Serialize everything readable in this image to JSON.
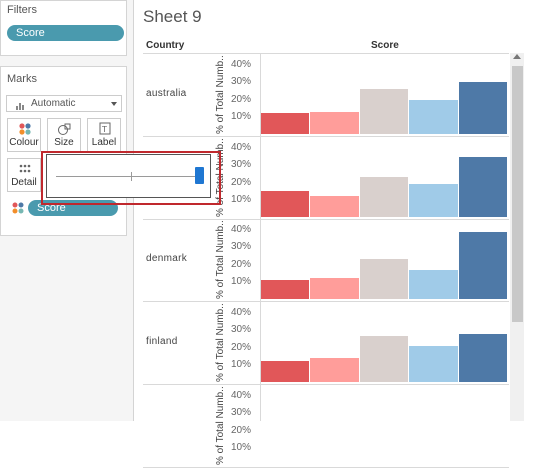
{
  "filters": {
    "title": "Filters",
    "pill": "Score"
  },
  "marks": {
    "title": "Marks",
    "mark_type": "Automatic",
    "buttons": [
      {
        "label": "Colour",
        "icon": "colour-dots-icon"
      },
      {
        "label": "Size",
        "icon": "size-shapes-icon"
      },
      {
        "label": "Label",
        "icon": "text-label-icon"
      },
      {
        "label": "Detail",
        "icon": "detail-dots-icon"
      }
    ],
    "score_pill": "Score"
  },
  "sheet": {
    "title": "Sheet 9",
    "column_header": "Country",
    "score_header": "Score",
    "y_axis_title": "% of Total Numb..",
    "ticks": [
      "40%",
      "30%",
      "20%",
      "10%"
    ],
    "countries": [
      "australia",
      "",
      "denmark",
      "finland",
      ""
    ]
  },
  "colors": {
    "pill": "#4a9aae",
    "bins": [
      "#e15759",
      "#ff9d9a",
      "#d9d0cd",
      "#a0cbe8",
      "#4e79a7"
    ],
    "popup_border": "#c0282d",
    "slider_thumb": "#1f77d2"
  },
  "chart_data": {
    "type": "bar",
    "x_header": "Score",
    "y_title": "% of Total Numb..",
    "ylim": [
      0,
      45
    ],
    "y_ticks": [
      "10%",
      "20%",
      "30%",
      "40%"
    ],
    "panels": [
      {
        "country": "australia",
        "values": [
          12,
          13,
          26,
          20,
          30
        ]
      },
      {
        "country": "",
        "values": [
          15,
          12,
          23,
          19,
          35
        ]
      },
      {
        "country": "denmark",
        "values": [
          11,
          12,
          23,
          17,
          39
        ]
      },
      {
        "country": "finland",
        "values": [
          12,
          14,
          27,
          21,
          28
        ]
      },
      {
        "country": "",
        "values": [
          null,
          null,
          null,
          null,
          4
        ]
      }
    ]
  }
}
